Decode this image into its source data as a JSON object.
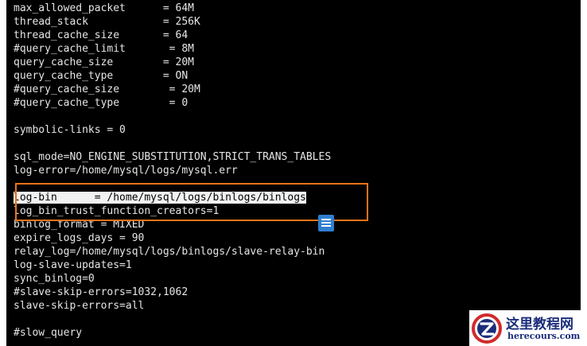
{
  "terminal": {
    "lines": [
      "max_allowed_packet      = 64M",
      "thread_stack            = 256K",
      "thread_cache_size       = 64",
      "#query_cache_limit       = 8M",
      "query_cache_size        = 20M",
      "query_cache_type        = ON",
      "#query_cache_size        = 20M",
      "#query_cache_type        = 0",
      "",
      "symbolic-links = 0",
      "",
      "sql_mode=NO_ENGINE_SUBSTITUTION,STRICT_TRANS_TABLES",
      "log-error=/home/mysql/logs/mysql.err",
      "",
      "log-bin      = /home/mysql/logs/binlogs/binlogs",
      "log_bin_trust_function_creators=1",
      "binlog_format = MIXED",
      "expire_logs_days = 90",
      "relay_log=/home/mysql/logs/binlogs/slave-relay-bin",
      "log-slave-updates=1",
      "sync_binlog=0",
      "#slave-skip-errors=1032,1062",
      "slave-skip-errors=all",
      "",
      "#slow_query"
    ]
  },
  "watermark": {
    "name": "这里教程网",
    "url": "herecours.com"
  },
  "colors": {
    "terminal_bg": "#000000",
    "terminal_text": "#e6e6e6",
    "highlight_border": "#e8731a",
    "selection_bg": "#f2f2f2",
    "watermark_text": "#1b2d7a"
  }
}
